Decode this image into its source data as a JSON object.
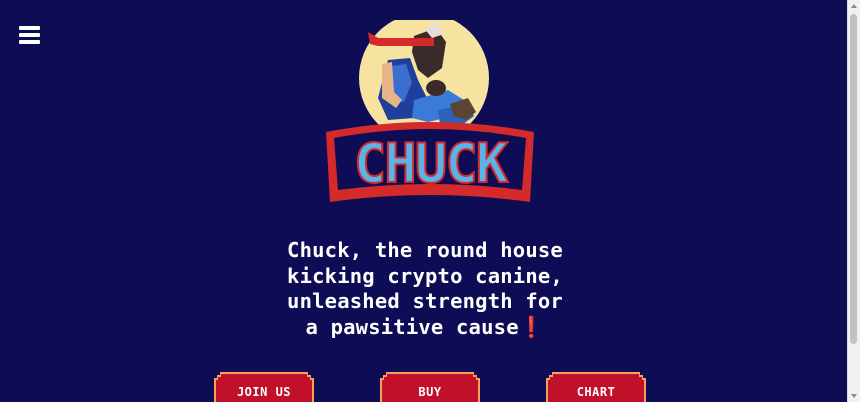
{
  "nav": {
    "menu_icon": "hamburger-menu-icon"
  },
  "hero": {
    "logo_text": "CHUCK",
    "tagline_lines": [
      "Chuck, the round house",
      "kicking crypto canine,",
      "unleashed strength for",
      "a pawsitive cause❗"
    ]
  },
  "buttons": {
    "join_label": "JOIN US",
    "buy_label": "BUY",
    "chart_label": "CHART"
  },
  "colors": {
    "background": "#0e0c55",
    "button_red": "#c0102a",
    "button_border": "#f4a259",
    "logo_blue": "#5bb4e8",
    "logo_red": "#d42a2a"
  }
}
